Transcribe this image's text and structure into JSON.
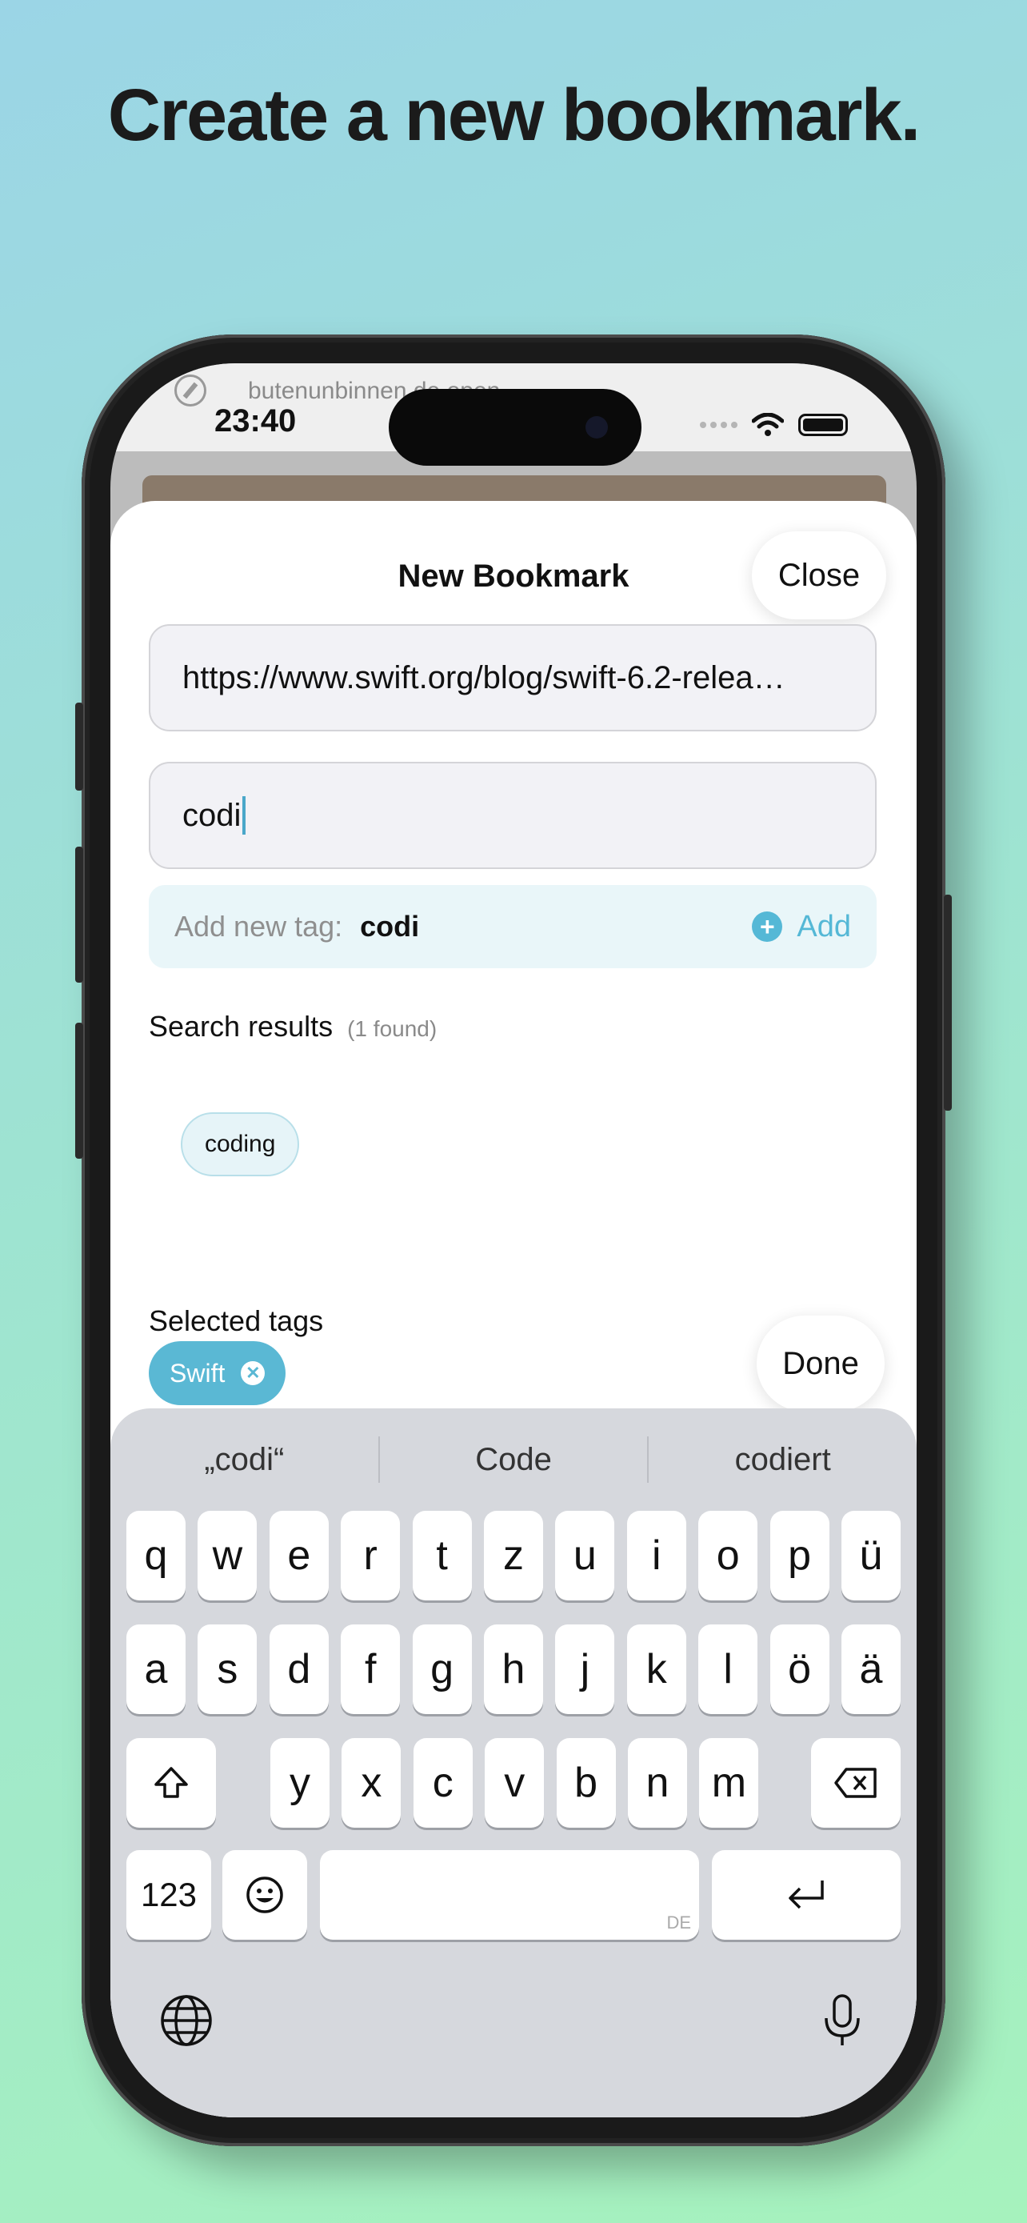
{
  "headline": "Create a new bookmark.",
  "status_bar": {
    "time": "23:40",
    "browser_url": "butenunbinnen.de open"
  },
  "sheet": {
    "title": "New Bookmark",
    "close_label": "Close",
    "url_value": "https://www.swift.org/blog/swift-6.2-relea…",
    "tag_input_value": "codi",
    "add_new_tag": {
      "label": "Add new tag:",
      "value": "codi",
      "add_label": "Add"
    },
    "search_results": {
      "label": "Search results",
      "count": "(1 found)",
      "items": [
        "coding"
      ]
    },
    "selected_tags": {
      "label": "Selected tags",
      "items": [
        "Swift"
      ]
    },
    "done_label": "Done"
  },
  "keyboard": {
    "suggestions": [
      "„codi“",
      "Code",
      "codiert"
    ],
    "row1": [
      "q",
      "w",
      "e",
      "r",
      "t",
      "z",
      "u",
      "i",
      "o",
      "p",
      "ü"
    ],
    "row2": [
      "a",
      "s",
      "d",
      "f",
      "g",
      "h",
      "j",
      "k",
      "l",
      "ö",
      "ä"
    ],
    "row3": [
      "y",
      "x",
      "c",
      "v",
      "b",
      "n",
      "m"
    ],
    "numbers_label": "123",
    "language_label": "DE",
    "icons": [
      "shift-icon",
      "backspace-icon",
      "emoji-icon",
      "return-icon",
      "globe-icon",
      "microphone-icon"
    ]
  },
  "colors": {
    "accent": "#55b8d6",
    "chip_bg": "#e6f4f8"
  }
}
